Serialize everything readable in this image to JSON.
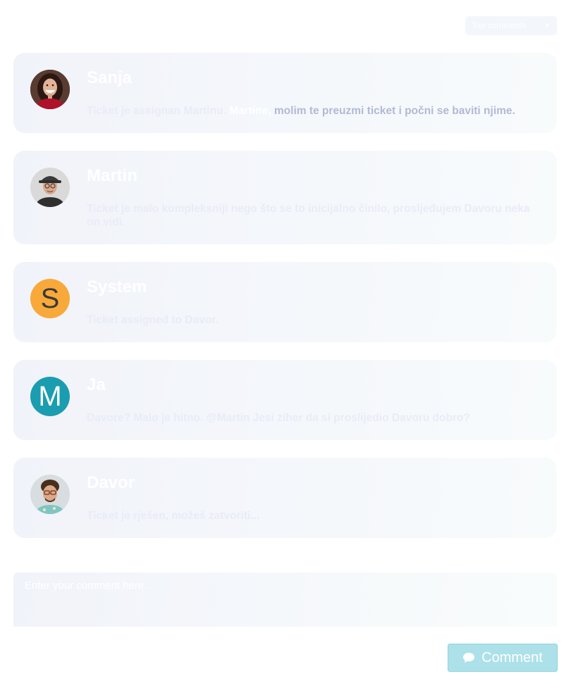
{
  "sort": {
    "selected": "Top comments"
  },
  "comments": [
    {
      "author": "Sanja",
      "avatar": "woman-photo-avatar",
      "text_before": "Ticket je assignan Martinu. ",
      "mention": "Martine,",
      "text_highlight": " molim te preuzmi ticket i počni se baviti njime."
    },
    {
      "author": "Martin",
      "avatar": "man-with-hat-photo-avatar",
      "text": "Ticket je malo kompleksniji nego što se to inicijalno činilo, prosljeđujem Davoru neka on vidi."
    },
    {
      "author": "System",
      "avatar_letter": "S",
      "avatar_bg": "#f8a93a",
      "avatar_fg": "#3a3a3a",
      "text": "Ticket assigned to Davor."
    },
    {
      "author": "Ja",
      "avatar_letter": "M",
      "avatar_bg": "#1a9db0",
      "avatar_fg": "#ffffff",
      "text": "Davore? Malo je hitno. @Martin Jesi ziher da si proslijedio Davoru dobro?"
    },
    {
      "author": "Davor",
      "avatar": "curly-hair-glasses-photo-avatar",
      "text": "Ticket je rješen, možeš zatvoriti..."
    }
  ],
  "composer": {
    "placeholder": "Enter your comment here...",
    "button_label": "Comment",
    "button_icon": "speech-bubble-icon"
  },
  "colors": {
    "accent": "#ade1e9",
    "card_bg": "#f2f5fa"
  }
}
